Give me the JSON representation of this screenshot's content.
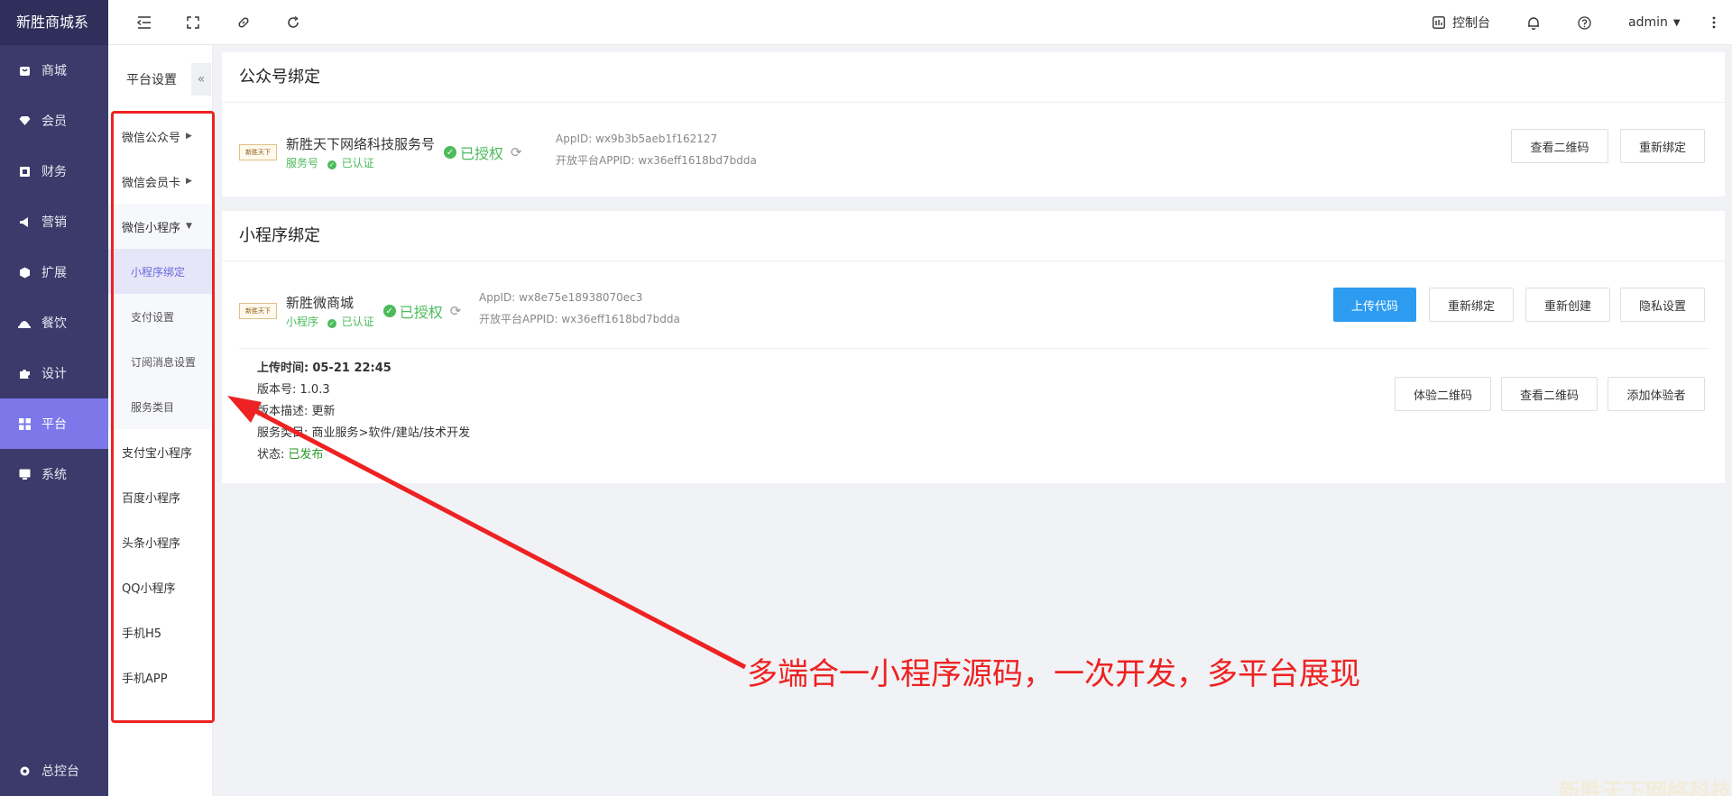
{
  "brand": "新胜商城系",
  "sidebar": {
    "items": [
      {
        "label": "商城",
        "icon": "shop-icon"
      },
      {
        "label": "会员",
        "icon": "diamond-icon"
      },
      {
        "label": "财务",
        "icon": "wallet-icon"
      },
      {
        "label": "营销",
        "icon": "megaphone-icon"
      },
      {
        "label": "扩展",
        "icon": "cube-icon"
      },
      {
        "label": "餐饮",
        "icon": "food-icon"
      },
      {
        "label": "设计",
        "icon": "puzzle-icon"
      },
      {
        "label": "平台",
        "icon": "grid-icon",
        "active": true
      },
      {
        "label": "系统",
        "icon": "monitor-icon"
      }
    ],
    "bottom": {
      "label": "总控台",
      "icon": "gear-icon"
    }
  },
  "topbar": {
    "console": "控制台",
    "user": "admin"
  },
  "submenu": {
    "title": "平台设置",
    "collapse": "«",
    "items": [
      "微信公众号",
      "微信会员卡",
      "微信小程序"
    ],
    "sub_items": [
      "小程序绑定",
      "支付设置",
      "订阅消息设置",
      "服务类目"
    ],
    "others": [
      "支付宝小程序",
      "百度小程序",
      "头条小程序",
      "QQ小程序",
      "手机H5",
      "手机APP"
    ]
  },
  "official": {
    "title": "公众号绑定",
    "logo_text": "新胜天下",
    "name": "新胜天下网络科技服务号",
    "type": "服务号",
    "verified": "已认证",
    "auth_status": "已授权",
    "appid_label": "AppID:",
    "appid": "wx9b3b5aeb1f162127",
    "platform_label": "开放平台APPID:",
    "platform_appid": "wx36eff1618bd7bdda",
    "btn_qr": "查看二维码",
    "btn_rebind": "重新绑定"
  },
  "mini": {
    "title": "小程序绑定",
    "logo_text": "新胜天下",
    "name": "新胜微商城",
    "type": "小程序",
    "verified": "已认证",
    "auth_status": "已授权",
    "appid_label": "AppID:",
    "appid": "wx8e75e18938070ec3",
    "platform_label": "开放平台APPID:",
    "platform_appid": "wx36eff1618bd7bdda",
    "btn_upload": "上传代码",
    "btn_rebind": "重新绑定",
    "btn_recreate": "重新创建",
    "btn_privacy": "隐私设置",
    "upload_time_label": "上传时间:",
    "upload_time": "05-21 22:45",
    "version_label": "版本号:",
    "version": "1.0.3",
    "desc_label": "版本描述:",
    "desc": "更新",
    "category_label": "服务类目:",
    "category": "商业服务>软件/建站/技术开发",
    "status_label": "状态:",
    "status": "已发布",
    "btn_exp_qr": "体验二维码",
    "btn_view_qr": "查看二维码",
    "btn_add_tester": "添加体验者"
  },
  "annotation": "多端合一小程序源码，一次开发，多平台展现",
  "watermark": "新胜天下网络科技",
  "colors": {
    "sidebar": "#3b3a6b",
    "active": "#7c78ea",
    "primary": "#2d9cf0",
    "success": "#4cbb5c",
    "annotation": "#ee2222"
  }
}
